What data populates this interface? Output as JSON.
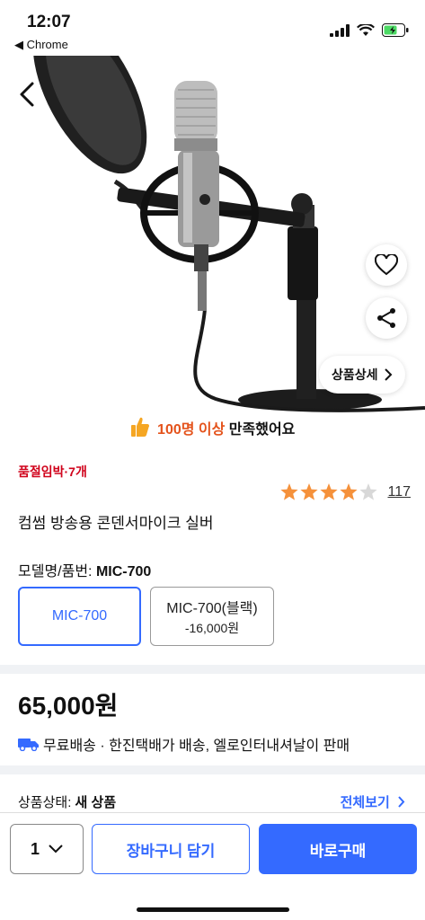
{
  "status_bar": {
    "time": "12:07",
    "back_app": "◀ Chrome"
  },
  "hero": {
    "image_alt": "condenser-microphone-product-image",
    "detail_label": "상품상세"
  },
  "satisfaction": {
    "highlight": "100명 이상",
    "rest": " 만족했어요"
  },
  "stock_notice": "품절임박·7개",
  "rating": {
    "stars": 4.5,
    "review_count": "117"
  },
  "product_title": "컴썸 방송용 콘덴서마이크 실버",
  "option": {
    "label_prefix": "모델명/품번: ",
    "selected": "MIC-700",
    "choices": [
      {
        "name": "MIC-700",
        "price_diff": ""
      },
      {
        "name": "MIC-700(블랙)",
        "price_diff": "-16,000원"
      }
    ]
  },
  "price": "65,000원",
  "shipping": "무료배송 · 한진택배가 배송, 엘로인터내셔날이 판매",
  "condition": {
    "label": "상품상태: ",
    "value": "새 상품",
    "view_all": "전체보기"
  },
  "bottom_bar": {
    "quantity": "1",
    "cart_label": "장바구니 담기",
    "buy_label": "바로구매"
  },
  "colors": {
    "accent": "#346aff",
    "stock": "#d0021b",
    "highlight": "#e4531c",
    "star": "#f5913b"
  }
}
